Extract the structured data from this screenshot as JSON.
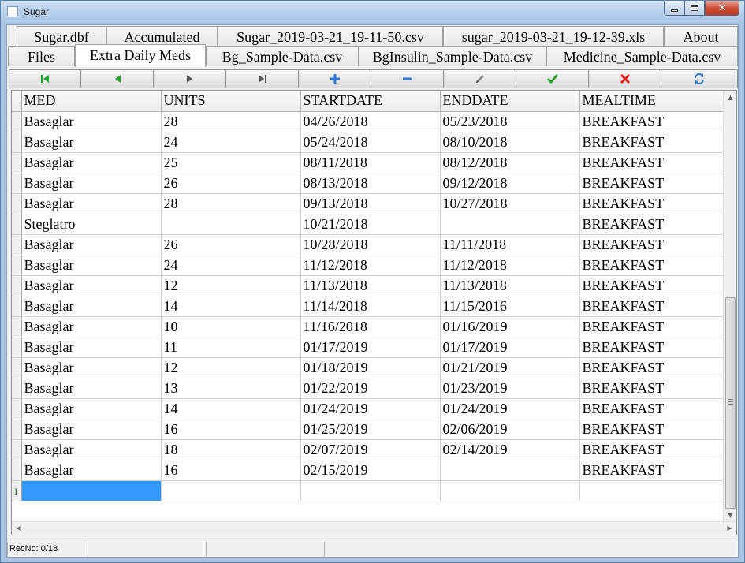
{
  "window": {
    "title": "Sugar"
  },
  "tabs_top": [
    "Sugar.dbf",
    "Accumulated",
    "Sugar_2019-03-21_19-11-50.csv",
    "sugar_2019-03-21_19-12-39.xls",
    "About"
  ],
  "tabs_bottom": [
    "Files",
    "Extra Daily Meds",
    "Bg_Sample-Data.csv",
    "BgInsulin_Sample-Data.csv",
    "Medicine_Sample-Data.csv"
  ],
  "active_tab": "Extra Daily Meds",
  "navigator": {
    "buttons": [
      {
        "name": "first-record",
        "icon": "first-icon",
        "color": "#22a22a"
      },
      {
        "name": "prior-record",
        "icon": "prior-icon",
        "color": "#22a22a"
      },
      {
        "name": "next-record",
        "icon": "next-icon",
        "color": "#555555"
      },
      {
        "name": "last-record",
        "icon": "last-icon",
        "color": "#555555"
      },
      {
        "name": "insert-record",
        "icon": "plus-icon",
        "color": "#2f78d6"
      },
      {
        "name": "delete-record",
        "icon": "minus-icon",
        "color": "#2f78d6"
      },
      {
        "name": "edit-record",
        "icon": "pencil-icon",
        "color": "#606060"
      },
      {
        "name": "post-record",
        "icon": "check-icon",
        "color": "#2aa02a"
      },
      {
        "name": "cancel-record",
        "icon": "x-icon",
        "color": "#e02020"
      },
      {
        "name": "refresh-record",
        "icon": "refresh-icon",
        "color": "#2f78d6"
      }
    ]
  },
  "grid": {
    "columns": [
      "MED",
      "UNITS",
      "STARTDATE",
      "ENDDATE",
      "MEALTIME"
    ],
    "rows": [
      [
        "Basaglar",
        "28",
        "04/26/2018",
        "05/23/2018",
        "BREAKFAST"
      ],
      [
        "Basaglar",
        "24",
        "05/24/2018",
        "08/10/2018",
        "BREAKFAST"
      ],
      [
        "Basaglar",
        "25",
        "08/11/2018",
        "08/12/2018",
        "BREAKFAST"
      ],
      [
        "Basaglar",
        "26",
        "08/13/2018",
        "09/12/2018",
        "BREAKFAST"
      ],
      [
        "Basaglar",
        "28",
        "09/13/2018",
        "10/27/2018",
        "BREAKFAST"
      ],
      [
        "Steglatro",
        "",
        "10/21/2018",
        "",
        "BREAKFAST"
      ],
      [
        "Basaglar",
        "26",
        "10/28/2018",
        "11/11/2018",
        "BREAKFAST"
      ],
      [
        "Basaglar",
        "24",
        "11/12/2018",
        "11/12/2018",
        "BREAKFAST"
      ],
      [
        "Basaglar",
        "12",
        "11/13/2018",
        "11/13/2018",
        "BREAKFAST"
      ],
      [
        "Basaglar",
        "14",
        "11/14/2018",
        "11/15/2016",
        "BREAKFAST"
      ],
      [
        "Basaglar",
        "10",
        "11/16/2018",
        "01/16/2019",
        "BREAKFAST"
      ],
      [
        "Basaglar",
        "11",
        "01/17/2019",
        "01/17/2019",
        "BREAKFAST"
      ],
      [
        "Basaglar",
        "12",
        "01/18/2019",
        "01/21/2019",
        "BREAKFAST"
      ],
      [
        "Basaglar",
        "13",
        "01/22/2019",
        "01/23/2019",
        "BREAKFAST"
      ],
      [
        "Basaglar",
        "14",
        "01/24/2019",
        "01/24/2019",
        "BREAKFAST"
      ],
      [
        "Basaglar",
        "16",
        "01/25/2019",
        "02/06/2019",
        "BREAKFAST"
      ],
      [
        "Basaglar",
        "18",
        "02/07/2019",
        "02/14/2019",
        "BREAKFAST"
      ],
      [
        "Basaglar",
        "16",
        "02/15/2019",
        "",
        "BREAKFAST"
      ],
      [
        "",
        "",
        "",
        "",
        ""
      ]
    ],
    "current_row_marker": "I"
  },
  "status": {
    "record": "RecNo: 0/18"
  }
}
